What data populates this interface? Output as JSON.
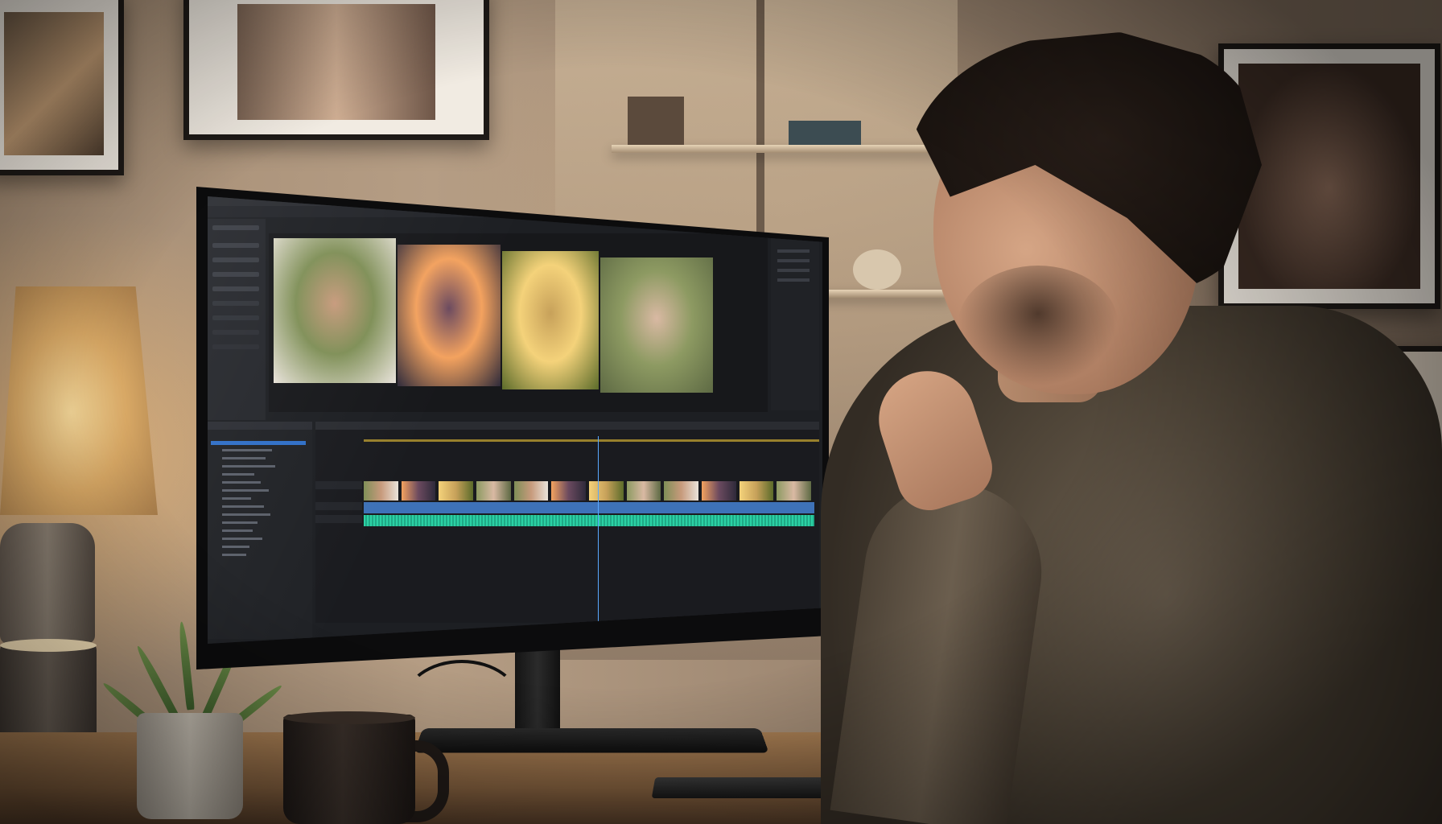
{
  "scene": {
    "description_tags": [
      "video-editor-monitor",
      "man-thinking",
      "desk-lamp",
      "framed-family-photos"
    ],
    "colors": {
      "wall": "#b59d84",
      "lamp_glow": "#f7d99a",
      "editor_bg": "#1d1f23",
      "timeline_blue": "#3e72b8",
      "audio_green": "#2bd1a4",
      "playhead": "#5aa9ff",
      "sweater": "#5f5447"
    }
  },
  "editor": {
    "preview_photos": [
      {
        "name": "mother-children-hug",
        "colors": [
          "#7f8f57",
          "#c79a7c",
          "#e9e3da"
        ]
      },
      {
        "name": "sunset-silhouettes",
        "colors": [
          "#f3a25f",
          "#6b4a5f",
          "#2e2a3a"
        ]
      },
      {
        "name": "mother-child-field",
        "colors": [
          "#f4d27a",
          "#c7a15a",
          "#5b6b2a"
        ]
      },
      {
        "name": "grandmother-daughter",
        "colors": [
          "#8d9a62",
          "#d9b9a3",
          "#5e6a44"
        ]
      }
    ],
    "timeline": {
      "clip_count": 12,
      "playhead_fraction": 0.52
    }
  }
}
